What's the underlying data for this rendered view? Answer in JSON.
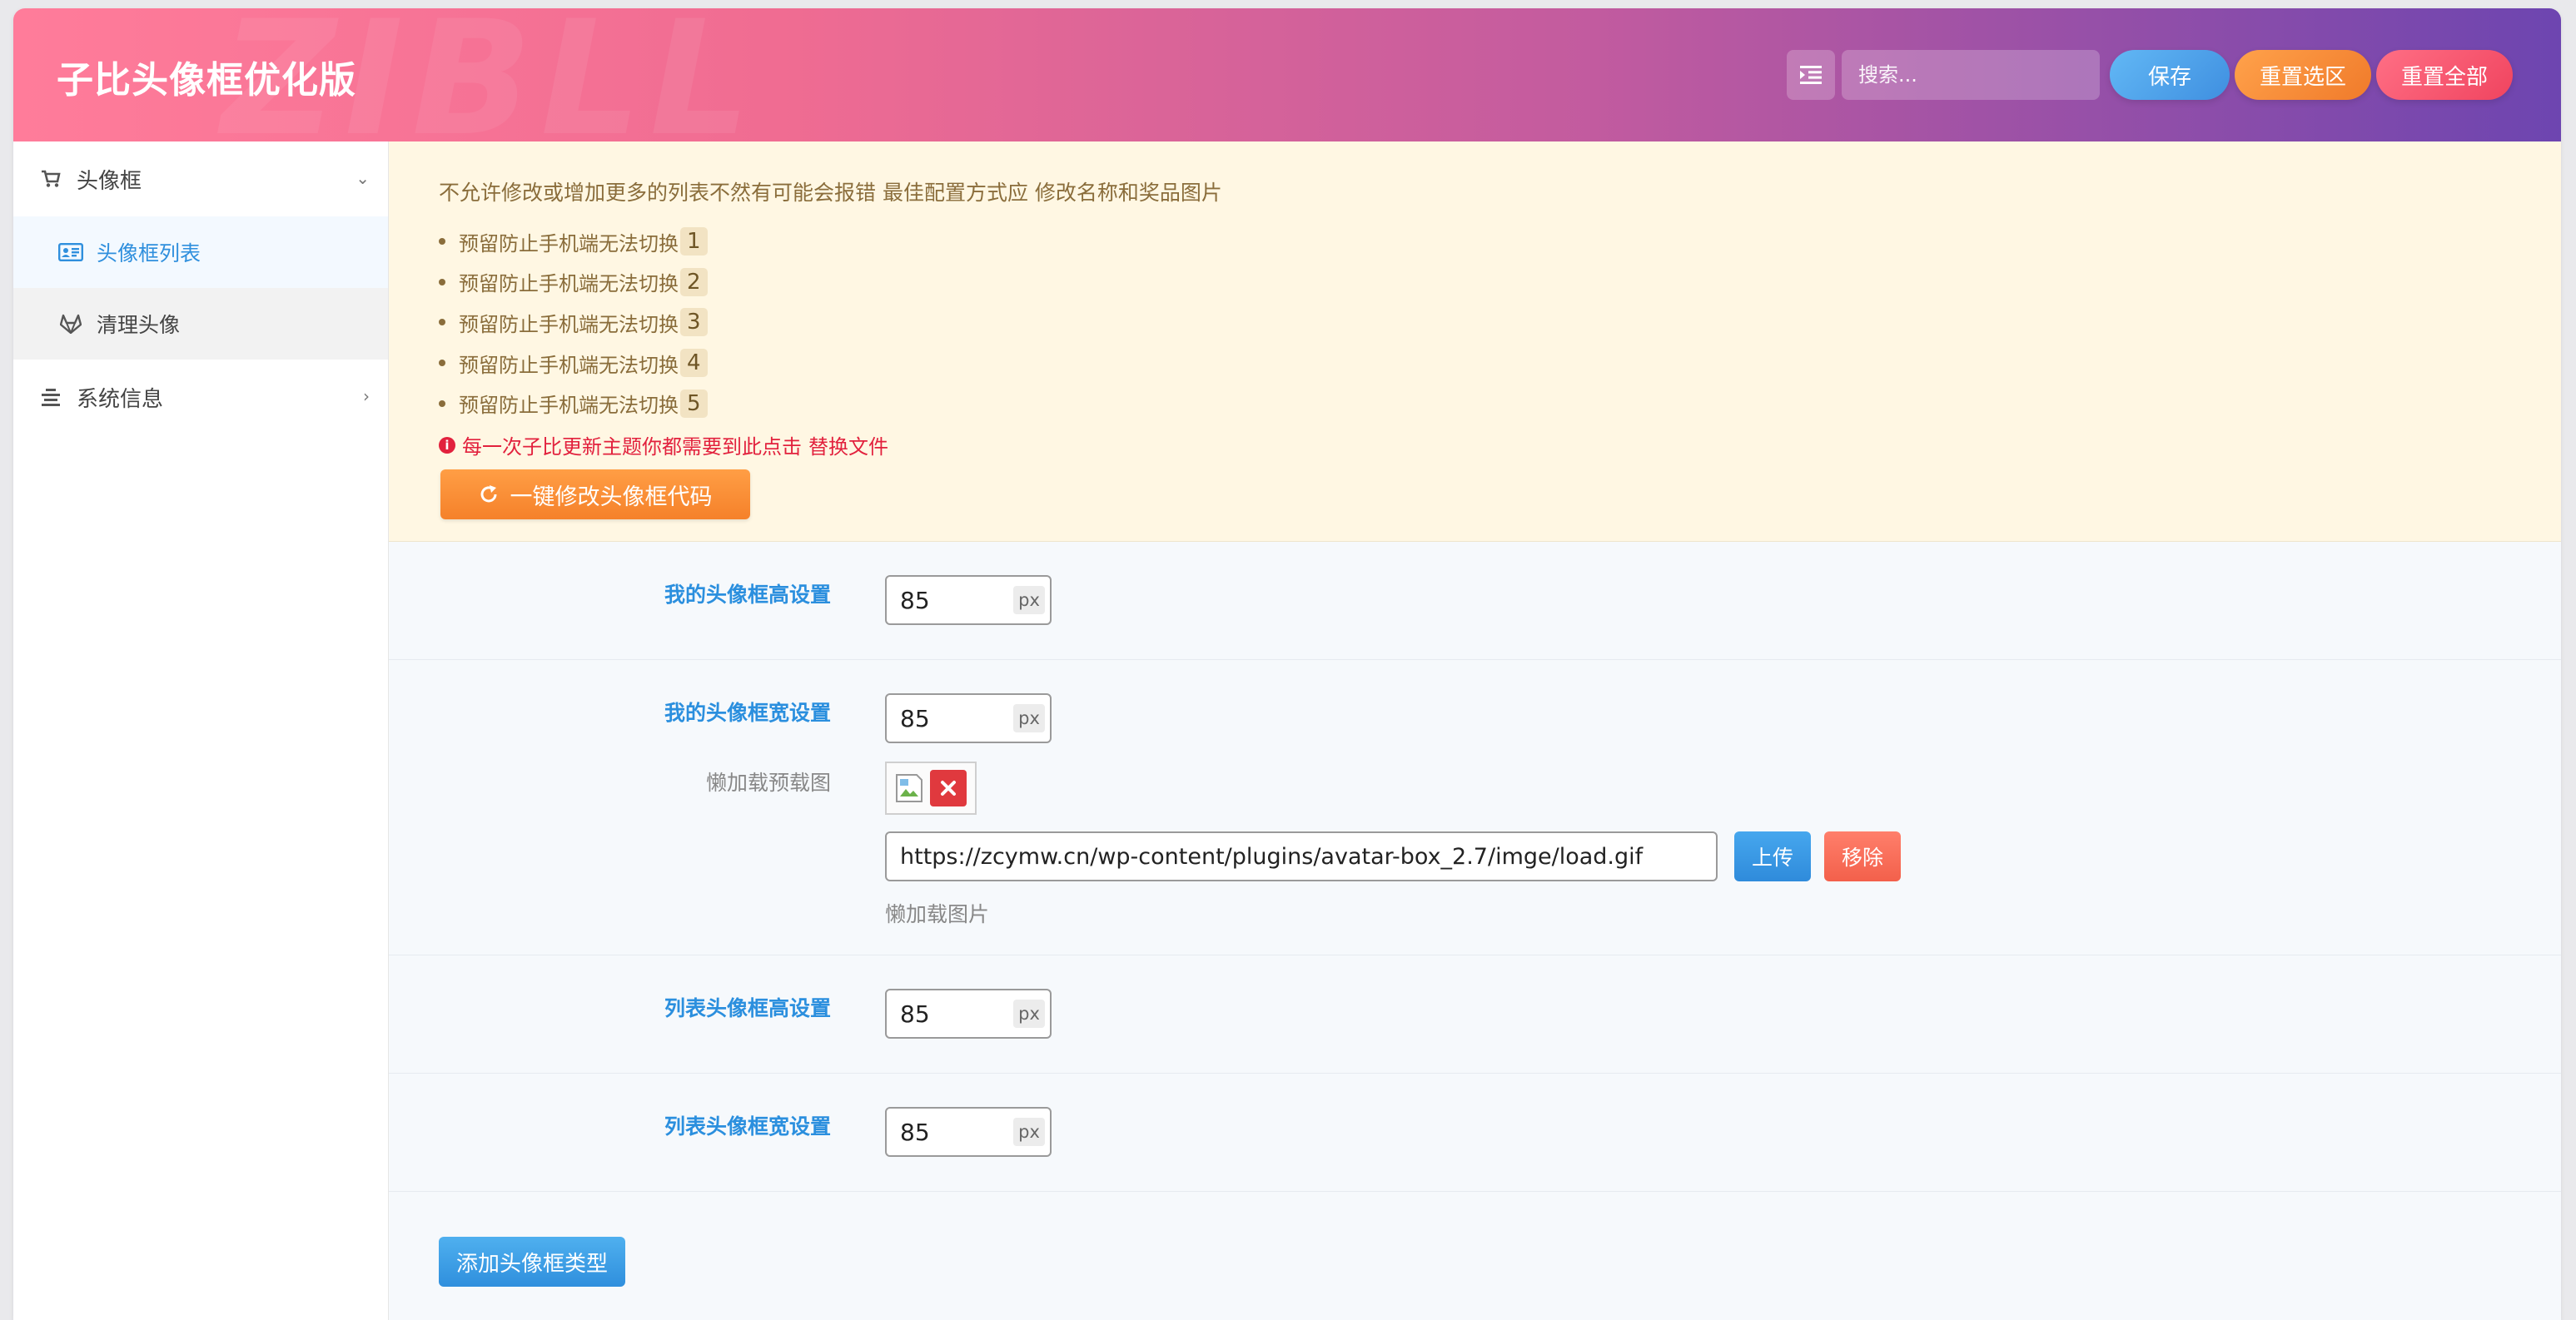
{
  "header": {
    "title": "子比头像框优化版",
    "watermark": "ZIBLL",
    "search_placeholder": "搜索...",
    "save_label": "保存",
    "reset_selection_label": "重置选区",
    "reset_all_label": "重置全部"
  },
  "sidebar": {
    "groups": [
      {
        "label": "头像框",
        "icon": "cart-icon",
        "items": [
          {
            "label": "头像框列表",
            "icon": "id-card-icon",
            "active": true
          },
          {
            "label": "清理头像",
            "icon": "gitlab-icon",
            "active": false
          }
        ]
      },
      {
        "label": "系统信息",
        "icon": "align-center-icon",
        "items": []
      }
    ]
  },
  "notice": {
    "text": "不允许修改或增加更多的列表不然有可能会报错 最佳配置方式应 修改名称和奖品图片",
    "items": [
      {
        "text": "预留防止手机端无法切换",
        "num": "1"
      },
      {
        "text": "预留防止手机端无法切换",
        "num": "2"
      },
      {
        "text": "预留防止手机端无法切换",
        "num": "3"
      },
      {
        "text": "预留防止手机端无法切换",
        "num": "4"
      },
      {
        "text": "预留防止手机端无法切换",
        "num": "5"
      }
    ],
    "warning": "每一次子比更新主题你都需要到此点击",
    "warning_link": "替换文件",
    "action_label": "一键修改头像框代码"
  },
  "fields": {
    "my_height": {
      "label": "我的头像框高设置",
      "value": "85",
      "unit": "px"
    },
    "my_width": {
      "label": "我的头像框宽设置",
      "value": "85",
      "unit": "px"
    },
    "lazy_preview": {
      "label": "懒加载预载图"
    },
    "lazy_url": {
      "value": "https://zcymw.cn/wp-content/plugins/avatar-box_2.7/imge/load.gif",
      "upload_label": "上传",
      "remove_label": "移除",
      "desc": "懒加载图片"
    },
    "list_height": {
      "label": "列表头像框高设置",
      "value": "85",
      "unit": "px"
    },
    "list_width": {
      "label": "列表头像框宽设置",
      "value": "85",
      "unit": "px"
    }
  },
  "add_type_label": "添加头像框类型"
}
